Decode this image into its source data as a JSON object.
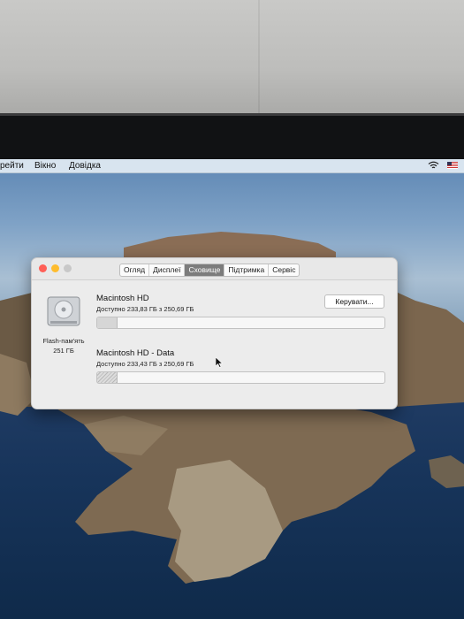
{
  "menubar": {
    "items": [
      "рейти",
      "Вікно",
      "Довідка"
    ],
    "wifi_icon": "wifi-icon",
    "flag_icon": "flag-icon"
  },
  "window": {
    "tabs": [
      {
        "label": "Огляд",
        "active": false
      },
      {
        "label": "Дисплеї",
        "active": false
      },
      {
        "label": "Сховище",
        "active": true
      },
      {
        "label": "Підтримка",
        "active": false
      },
      {
        "label": "Сервіс",
        "active": false
      }
    ],
    "disk": {
      "icon": "hard-drive-icon",
      "type_label": "Flash-пам'ять",
      "capacity_label": "251 ГБ"
    },
    "volumes": [
      {
        "name": "Macintosh HD",
        "available": "Доступно 233,83 ГБ з 250,69 ГБ",
        "used_fraction": 0.067
      },
      {
        "name": "Macintosh HD - Data",
        "available": "Доступно 233,43 ГБ з 250,69 ГБ",
        "used_fraction": 0.069
      }
    ],
    "manage_button": "Керувати..."
  },
  "colors": {
    "close": "#ff5f57",
    "minimize": "#febc2e",
    "zoom": "#c8c8c8",
    "active_tab": "#7c7c7c"
  }
}
